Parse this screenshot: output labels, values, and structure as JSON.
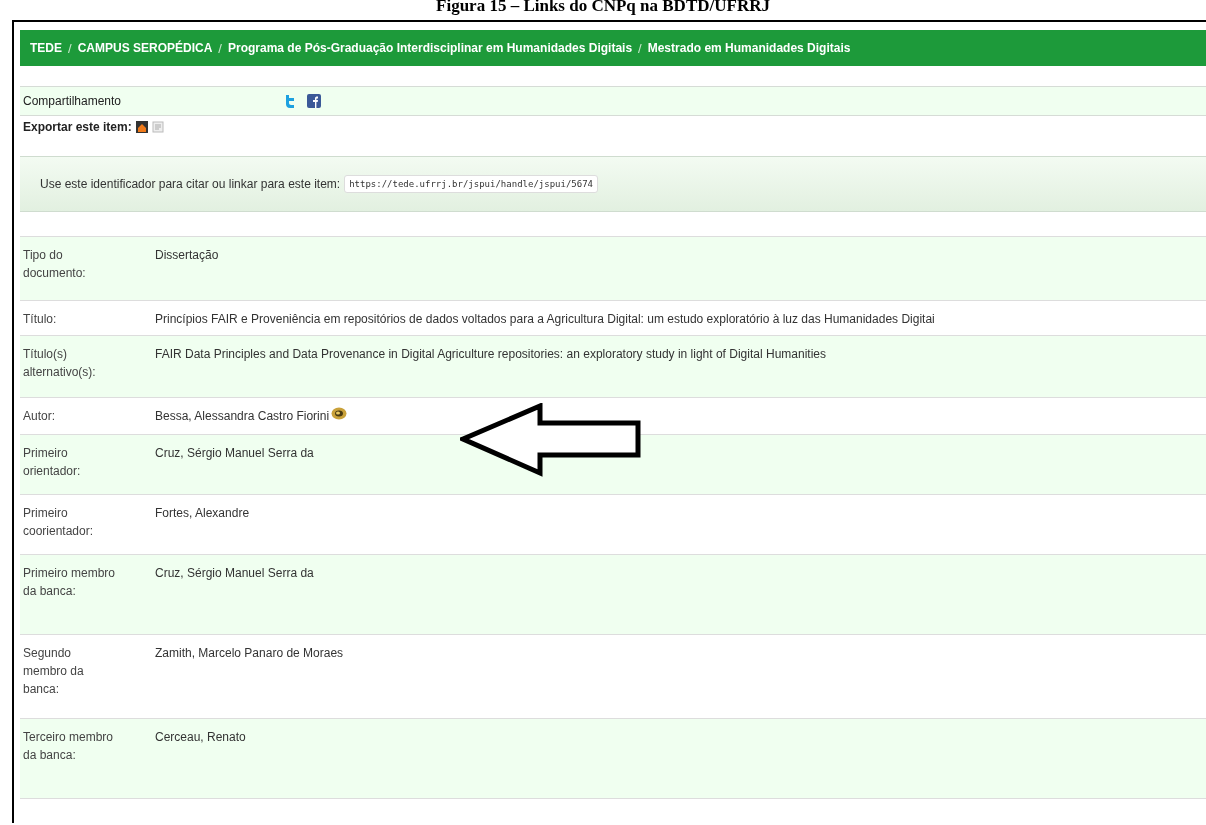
{
  "caption": "Figura 15 – Links do CNPq na BDTD/UFRRJ",
  "breadcrumb_separator": "/",
  "breadcrumb": [
    "TEDE",
    "CAMPUS SEROPÉDICA",
    "Programa de Pós-Graduação Interdisciplinar em Humanidades Digitais",
    "Mestrado em Humanidades Digitais"
  ],
  "share": {
    "label": "Compartilhamento"
  },
  "export": {
    "label": "Exportar este item:"
  },
  "identifier": {
    "label": "Use este identificador para citar ou linkar para este item:",
    "value": "https://tede.ufrrj.br/jspui/handle/jspui/5674"
  },
  "rows": [
    {
      "label": "Tipo do documento:",
      "value": "Dissertação"
    },
    {
      "label": "Título:",
      "value": "Princípios FAIR e Proveniência em repositórios de dados voltados para a Agricultura Digital: um estudo exploratório à luz das Humanidades Digitai"
    },
    {
      "label": "Título(s) alternativo(s):",
      "value": "FAIR Data Principles and Data Provenance in Digital Agriculture repositories: an exploratory study in light of Digital Humanities"
    },
    {
      "label": "Autor:",
      "value": "Bessa, Alessandra Castro Fiorini",
      "kind": "author"
    },
    {
      "label": "Primeiro orientador:",
      "value": "Cruz, Sérgio Manuel Serra da"
    },
    {
      "label": "Primeiro coorientador:",
      "value": "Fortes, Alexandre"
    },
    {
      "label": "Primeiro membro da banca:",
      "value": "Cruz, Sérgio Manuel Serra da"
    },
    {
      "label": "Segundo membro da banca:",
      "value": "Zamith, Marcelo Panaro de Moraes"
    },
    {
      "label": "Terceiro membro da banca:",
      "value": "Cerceau, Renato"
    }
  ]
}
